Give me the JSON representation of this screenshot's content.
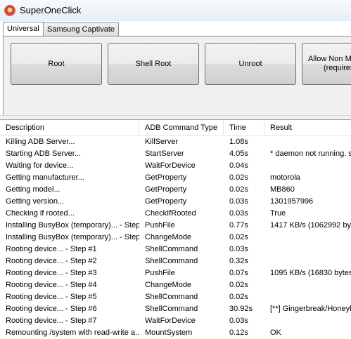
{
  "window": {
    "title": "SuperOneClick"
  },
  "tabs": [
    {
      "label": "Universal",
      "active": true
    },
    {
      "label": "Samsung Captivate",
      "active": false
    }
  ],
  "buttons": {
    "root": "Root",
    "shell_root": "Shell Root",
    "unroot": "Unroot",
    "allow_non_market_line1": "Allow Non Ma",
    "allow_non_market_line2": "(requires"
  },
  "table": {
    "columns": [
      "Description",
      "ADB Command Type",
      "Time",
      "Result"
    ],
    "rows": [
      [
        "Killing ADB Server...",
        "KillServer",
        "1.08s",
        ""
      ],
      [
        "Starting ADB Server...",
        "StartServer",
        "4.05s",
        "* daemon not running. st"
      ],
      [
        "Waiting for device...",
        "WaitForDevice",
        "0.04s",
        ""
      ],
      [
        "Getting manufacturer...",
        "GetProperty",
        "0.02s",
        "motorola"
      ],
      [
        "Getting model...",
        "GetProperty",
        "0.02s",
        "MB860"
      ],
      [
        "Getting version...",
        "GetProperty",
        "0.03s",
        "1301957996"
      ],
      [
        "Checking if rooted...",
        "CheckIfRooted",
        "0.03s",
        "True"
      ],
      [
        "Installing BusyBox (temporary)... - Step...",
        "PushFile",
        "0.77s",
        "1417 KB/s (1062992 byt"
      ],
      [
        "Installing BusyBox (temporary)... - Step...",
        "ChangeMode",
        "0.02s",
        ""
      ],
      [
        "Rooting device... - Step #1",
        "ShellCommand",
        "0.03s",
        ""
      ],
      [
        "Rooting device... - Step #2",
        "ShellCommand",
        "0.32s",
        ""
      ],
      [
        "Rooting device... - Step #3",
        "PushFile",
        "0.07s",
        "1095 KB/s (16830 bytes"
      ],
      [
        "Rooting device... - Step #4",
        "ChangeMode",
        "0.02s",
        ""
      ],
      [
        "Rooting device... - Step #5",
        "ShellCommand",
        "0.02s",
        ""
      ],
      [
        "Rooting device... - Step #6",
        "ShellCommand",
        "30.92s",
        "[**] Gingerbreak/Honeyb"
      ],
      [
        "Rooting device... - Step #7",
        "WaitForDevice",
        "0.03s",
        ""
      ],
      [
        "Remounting /system with read-write a...",
        "MountSystem",
        "0.12s",
        "OK"
      ]
    ]
  }
}
